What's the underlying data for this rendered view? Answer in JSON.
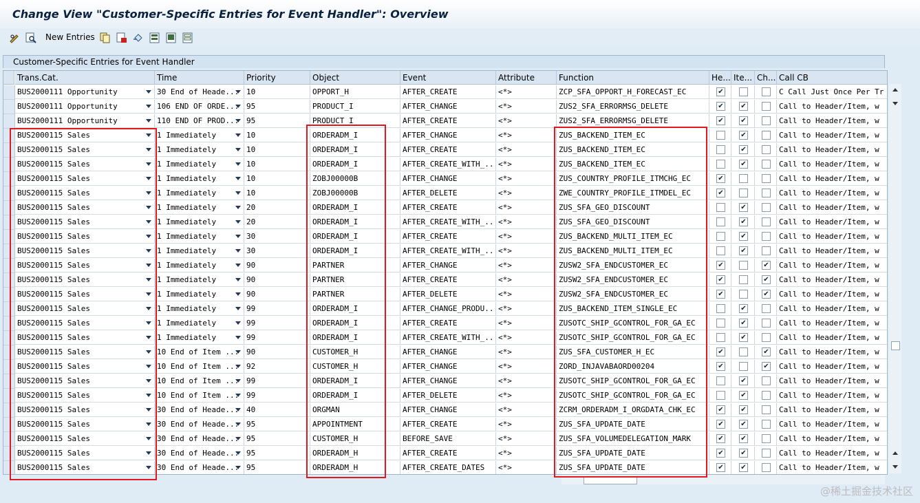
{
  "window_title": "Change View \"Customer-Specific Entries for Event Handler\": Overview",
  "toolbar": {
    "icons": [
      "glasses-pen-icon",
      "find-icon",
      "copy-icon",
      "delete-icon",
      "undo-icon",
      "select-all-icon",
      "select-block-icon",
      "deselect-all-icon"
    ],
    "new_entries_label": "New Entries"
  },
  "panel_title": "Customer-Specific Entries for Event Handler",
  "columns": [
    "Trans.Cat.",
    "Time",
    "Priority",
    "Object",
    "Event",
    "Attribute",
    "Function",
    "He...",
    "Ite...",
    "Ch...",
    "Call CB"
  ],
  "rows": [
    {
      "trans": "BUS2000111 Opportunity",
      "time": "30 End of Heade...",
      "prio": "10",
      "obj": "OPPORT_H",
      "event": "AFTER_CREATE",
      "attr": "<*>",
      "func": "ZCP_SFA_OPPORT_H_FORECAST_EC",
      "he": true,
      "ite": false,
      "ch": false,
      "call": "C Call Just Once Per Tr"
    },
    {
      "trans": "BUS2000111 Opportunity",
      "time": "106 END OF ORDE...",
      "prio": "95",
      "obj": "PRODUCT_I",
      "event": "AFTER_CHANGE",
      "attr": "<*>",
      "func": "ZUS2_SFA_ERRORMSG_DELETE",
      "he": true,
      "ite": true,
      "ch": false,
      "call": "Call to Header/Item, w"
    },
    {
      "trans": "BUS2000111 Opportunity",
      "time": "110 END OF PROD...",
      "prio": "95",
      "obj": "PRODUCT_I",
      "event": "AFTER_CREATE",
      "attr": "<*>",
      "func": "ZUS2_SFA_ERRORMSG_DELETE",
      "he": true,
      "ite": true,
      "ch": false,
      "call": "Call to Header/Item, w"
    },
    {
      "trans": "BUS2000115 Sales",
      "time": "1 Immediately",
      "prio": "10",
      "obj": "ORDERADM_I",
      "event": "AFTER_CHANGE",
      "attr": "<*>",
      "func": "ZUS_BACKEND_ITEM_EC",
      "he": false,
      "ite": true,
      "ch": false,
      "call": "Call to Header/Item, w"
    },
    {
      "trans": "BUS2000115 Sales",
      "time": "1 Immediately",
      "prio": "10",
      "obj": "ORDERADM_I",
      "event": "AFTER_CREATE",
      "attr": "<*>",
      "func": "ZUS_BACKEND_ITEM_EC",
      "he": false,
      "ite": true,
      "ch": false,
      "call": "Call to Header/Item, w"
    },
    {
      "trans": "BUS2000115 Sales",
      "time": "1 Immediately",
      "prio": "10",
      "obj": "ORDERADM_I",
      "event": "AFTER_CREATE_WITH_...",
      "attr": "<*>",
      "func": "ZUS_BACKEND_ITEM_EC",
      "he": false,
      "ite": true,
      "ch": false,
      "call": "Call to Header/Item, w"
    },
    {
      "trans": "BUS2000115 Sales",
      "time": "1 Immediately",
      "prio": "10",
      "obj": "ZOBJ00000B",
      "event": "AFTER_CHANGE",
      "attr": "<*>",
      "func": "ZUS_COUNTRY_PROFILE_ITMCHG_EC",
      "he": true,
      "ite": false,
      "ch": false,
      "call": "Call to Header/Item, w"
    },
    {
      "trans": "BUS2000115 Sales",
      "time": "1 Immediately",
      "prio": "10",
      "obj": "ZOBJ00000B",
      "event": "AFTER_DELETE",
      "attr": "<*>",
      "func": "ZWE_COUNTRY_PROFILE_ITMDEL_EC",
      "he": true,
      "ite": false,
      "ch": false,
      "call": "Call to Header/Item, w"
    },
    {
      "trans": "BUS2000115 Sales",
      "time": "1 Immediately",
      "prio": "20",
      "obj": "ORDERADM_I",
      "event": "AFTER_CREATE",
      "attr": "<*>",
      "func": "ZUS_SFA_GEO_DISCOUNT",
      "he": false,
      "ite": true,
      "ch": false,
      "call": "Call to Header/Item, w"
    },
    {
      "trans": "BUS2000115 Sales",
      "time": "1 Immediately",
      "prio": "20",
      "obj": "ORDERADM_I",
      "event": "AFTER_CREATE_WITH_...",
      "attr": "<*>",
      "func": "ZUS_SFA_GEO_DISCOUNT",
      "he": false,
      "ite": true,
      "ch": false,
      "call": "Call to Header/Item, w"
    },
    {
      "trans": "BUS2000115 Sales",
      "time": "1 Immediately",
      "prio": "30",
      "obj": "ORDERADM_I",
      "event": "AFTER_CREATE",
      "attr": "<*>",
      "func": "ZUS_BACKEND_MULTI_ITEM_EC",
      "he": false,
      "ite": true,
      "ch": false,
      "call": "Call to Header/Item, w"
    },
    {
      "trans": "BUS2000115 Sales",
      "time": "1 Immediately",
      "prio": "30",
      "obj": "ORDERADM_I",
      "event": "AFTER_CREATE_WITH_...",
      "attr": "<*>",
      "func": "ZUS_BACKEND_MULTI_ITEM_EC",
      "he": false,
      "ite": true,
      "ch": false,
      "call": "Call to Header/Item, w"
    },
    {
      "trans": "BUS2000115 Sales",
      "time": "1 Immediately",
      "prio": "90",
      "obj": "PARTNER",
      "event": "AFTER_CHANGE",
      "attr": "<*>",
      "func": "ZUSW2_SFA_ENDCUSTOMER_EC",
      "he": true,
      "ite": false,
      "ch": true,
      "call": "Call to Header/Item, w"
    },
    {
      "trans": "BUS2000115 Sales",
      "time": "1 Immediately",
      "prio": "90",
      "obj": "PARTNER",
      "event": "AFTER_CREATE",
      "attr": "<*>",
      "func": "ZUSW2_SFA_ENDCUSTOMER_EC",
      "he": true,
      "ite": false,
      "ch": true,
      "call": "Call to Header/Item, w"
    },
    {
      "trans": "BUS2000115 Sales",
      "time": "1 Immediately",
      "prio": "90",
      "obj": "PARTNER",
      "event": "AFTER_DELETE",
      "attr": "<*>",
      "func": "ZUSW2_SFA_ENDCUSTOMER_EC",
      "he": true,
      "ite": false,
      "ch": true,
      "call": "Call to Header/Item, w"
    },
    {
      "trans": "BUS2000115 Sales",
      "time": "1 Immediately",
      "prio": "99",
      "obj": "ORDERADM_I",
      "event": "AFTER_CHANGE_PRODU...",
      "attr": "<*>",
      "func": "ZUS_BACKEND_ITEM_SINGLE_EC",
      "he": false,
      "ite": true,
      "ch": false,
      "call": "Call to Header/Item, w"
    },
    {
      "trans": "BUS2000115 Sales",
      "time": "1 Immediately",
      "prio": "99",
      "obj": "ORDERADM_I",
      "event": "AFTER_CREATE",
      "attr": "<*>",
      "func": "ZUSOTC_SHIP_GCONTROL_FOR_GA_EC",
      "he": false,
      "ite": true,
      "ch": false,
      "call": "Call to Header/Item, w"
    },
    {
      "trans": "BUS2000115 Sales",
      "time": "1 Immediately",
      "prio": "99",
      "obj": "ORDERADM_I",
      "event": "AFTER_CREATE_WITH_...",
      "attr": "<*>",
      "func": "ZUSOTC_SHIP_GCONTROL_FOR_GA_EC",
      "he": false,
      "ite": true,
      "ch": false,
      "call": "Call to Header/Item, w"
    },
    {
      "trans": "BUS2000115 Sales",
      "time": "10 End of Item ...",
      "prio": "90",
      "obj": "CUSTOMER_H",
      "event": "AFTER_CHANGE",
      "attr": "<*>",
      "func": "ZUS_SFA_CUSTOMER_H_EC",
      "he": true,
      "ite": false,
      "ch": true,
      "call": "Call to Header/Item, w"
    },
    {
      "trans": "BUS2000115 Sales",
      "time": "10 End of Item ...",
      "prio": "92",
      "obj": "CUSTOMER_H",
      "event": "AFTER_CHANGE",
      "attr": "<*>",
      "func": "ZORD_INJAVABAORD00204",
      "he": true,
      "ite": false,
      "ch": true,
      "call": "Call to Header/Item, w"
    },
    {
      "trans": "BUS2000115 Sales",
      "time": "10 End of Item ...",
      "prio": "99",
      "obj": "ORDERADM_I",
      "event": "AFTER_CHANGE",
      "attr": "<*>",
      "func": "ZUSOTC_SHIP_GCONTROL_FOR_GA_EC",
      "he": false,
      "ite": true,
      "ch": false,
      "call": "Call to Header/Item, w"
    },
    {
      "trans": "BUS2000115 Sales",
      "time": "10 End of Item ...",
      "prio": "99",
      "obj": "ORDERADM_I",
      "event": "AFTER_DELETE",
      "attr": "<*>",
      "func": "ZUSOTC_SHIP_GCONTROL_FOR_GA_EC",
      "he": false,
      "ite": true,
      "ch": false,
      "call": "Call to Header/Item, w"
    },
    {
      "trans": "BUS2000115 Sales",
      "time": "30 End of Heade...",
      "prio": "40",
      "obj": "ORGMAN",
      "event": "AFTER_CHANGE",
      "attr": "<*>",
      "func": "ZCRM_ORDERADM_I_ORGDATA_CHK_EC",
      "he": true,
      "ite": true,
      "ch": false,
      "call": "Call to Header/Item, w"
    },
    {
      "trans": "BUS2000115 Sales",
      "time": "30 End of Heade...",
      "prio": "95",
      "obj": "APPOINTMENT",
      "event": "AFTER_CREATE",
      "attr": "<*>",
      "func": "ZUS_SFA_UPDATE_DATE",
      "he": true,
      "ite": true,
      "ch": false,
      "call": "Call to Header/Item, w"
    },
    {
      "trans": "BUS2000115 Sales",
      "time": "30 End of Heade...",
      "prio": "95",
      "obj": "CUSTOMER_H",
      "event": "BEFORE_SAVE",
      "attr": "<*>",
      "func": "ZUS_SFA_VOLUMEDELEGATION_MARK",
      "he": true,
      "ite": true,
      "ch": false,
      "call": "Call to Header/Item, w"
    },
    {
      "trans": "BUS2000115 Sales",
      "time": "30 End of Heade...",
      "prio": "95",
      "obj": "ORDERADM_H",
      "event": "AFTER_CREATE",
      "attr": "<*>",
      "func": "ZUS_SFA_UPDATE_DATE",
      "he": true,
      "ite": true,
      "ch": false,
      "call": "Call to Header/Item, w"
    },
    {
      "trans": "BUS2000115 Sales",
      "time": "30 End of Heade...",
      "prio": "95",
      "obj": "ORDERADM_H",
      "event": "AFTER_CREATE_DATES",
      "attr": "<*>",
      "func": "ZUS_SFA_UPDATE_DATE",
      "he": true,
      "ite": true,
      "ch": false,
      "call": "Call to Header/Item, w"
    }
  ],
  "watermark": "@稀土掘金技术社区",
  "colors": {
    "highlight": "#e0191f",
    "header": "#d9e6f2",
    "readonly": "#e9eff5"
  }
}
